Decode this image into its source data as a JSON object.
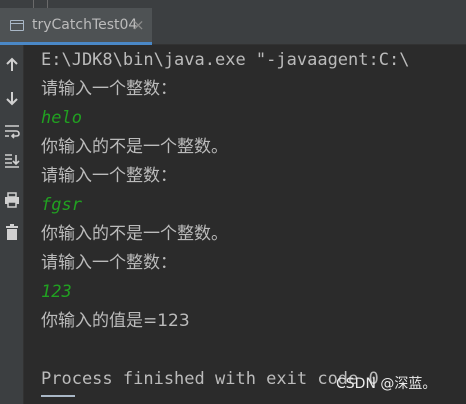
{
  "tab": {
    "title": "tryCatchTest04",
    "close": "×"
  },
  "toolbar": {
    "icons": [
      "arrow-up-icon",
      "arrow-down-icon",
      "soft-wrap-icon",
      "scroll-to-end-icon",
      "print-icon",
      "trash-icon"
    ]
  },
  "console": {
    "lines": [
      {
        "text": "E:\\JDK8\\bin\\java.exe \"-javaagent:C:\\",
        "kind": "output"
      },
      {
        "text": "请输入一个整数：",
        "kind": "output"
      },
      {
        "text": "helo",
        "kind": "input"
      },
      {
        "text": "你输入的不是一个整数。",
        "kind": "output"
      },
      {
        "text": "请输入一个整数：",
        "kind": "output"
      },
      {
        "text": "fgsr",
        "kind": "input"
      },
      {
        "text": "你输入的不是一个整数。",
        "kind": "output"
      },
      {
        "text": "请输入一个整数：",
        "kind": "output"
      },
      {
        "text": "123",
        "kind": "input"
      },
      {
        "text": "你输入的值是=123",
        "kind": "output"
      },
      {
        "text": "",
        "kind": "output"
      },
      {
        "text": "Process finished with exit code 0",
        "kind": "output"
      }
    ]
  },
  "watermark": "CSDN @深蓝。",
  "colors": {
    "background": "#2b2b2b",
    "output_text": "#bbbbbb",
    "input_text": "#21a121",
    "tab_underline": "#4a88c7"
  }
}
